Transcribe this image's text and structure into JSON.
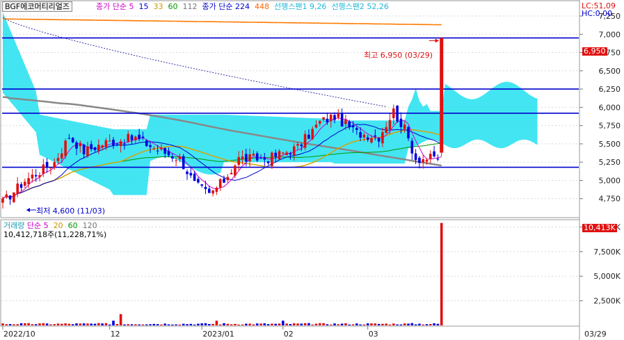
{
  "header": {
    "stock_name": "BGF에코머티리얼즈",
    "ma_label": "종가 단순",
    "ma_periods": [
      "5",
      "15",
      "33",
      "60",
      "112"
    ],
    "ma_period_colors": [
      "#cc00cc",
      "#0000cc",
      "#cc9900",
      "#009900",
      "#777777"
    ],
    "ma2_label": "종가 단순",
    "ma2_periods": [
      "224",
      "448"
    ],
    "ma2_period_colors": [
      "#0000cc",
      "#ff6600"
    ],
    "span1": "선행스팬1 9,26",
    "span2": "선행스팬2 52,26",
    "lc": "LC:51,09",
    "hc": "HC:0,00"
  },
  "volume_header": {
    "label": "거래량",
    "ma_label": "단순",
    "periods": [
      "5",
      "20",
      "60",
      "120"
    ],
    "period_colors": [
      "#cc00cc",
      "#cc9900",
      "#009900",
      "#777777"
    ],
    "current": "10,412,718주(11,228,71%)"
  },
  "annotations": {
    "high": "최고 6,950 (03/29)",
    "low": "최저 4,600 (11/03)",
    "price_tag": "6,950",
    "volume_tag": "10,413K"
  },
  "chart_data": [
    {
      "type": "candlestick",
      "panel": "price",
      "y_ticks": [
        7250,
        7000,
        6750,
        6500,
        6250,
        6000,
        5750,
        5500,
        5250,
        5000,
        4750
      ],
      "y_tick_labels": [
        "7,250",
        "7,000",
        "6,750",
        "6,500",
        "6,250",
        "6,000",
        "5,750",
        "5,500",
        "5,250",
        "5,000",
        "4,750"
      ],
      "ylim": [
        4500,
        7450
      ],
      "horizontal_lines": [
        6950,
        6250,
        5920,
        5180
      ],
      "high": {
        "value": 6950,
        "date": "03/29"
      },
      "low": {
        "value": 4600,
        "date": "11/03"
      },
      "last": 6950,
      "candles_start": 4700,
      "candle_count": 120,
      "spike": {
        "open": 5380,
        "close": 6950,
        "high": 6950,
        "low": 5330
      },
      "ma_long_start": 7210,
      "ma_long_end": 7130,
      "dotted_start": 7230,
      "dotted_end": 5870
    },
    {
      "type": "bar",
      "panel": "volume",
      "y_ticks": [
        10000,
        7500,
        5000,
        2500
      ],
      "y_tick_labels": [
        "10,000K",
        "7,500K",
        "5,000K",
        "2,500K"
      ],
      "ylim": [
        0,
        10600
      ],
      "last": 10413,
      "typical": 160,
      "peak_early": 1150
    }
  ],
  "x_axis": {
    "labels": [
      "2022/10",
      "12",
      "2023/01",
      "02",
      "03"
    ],
    "end_label": "03/29"
  }
}
